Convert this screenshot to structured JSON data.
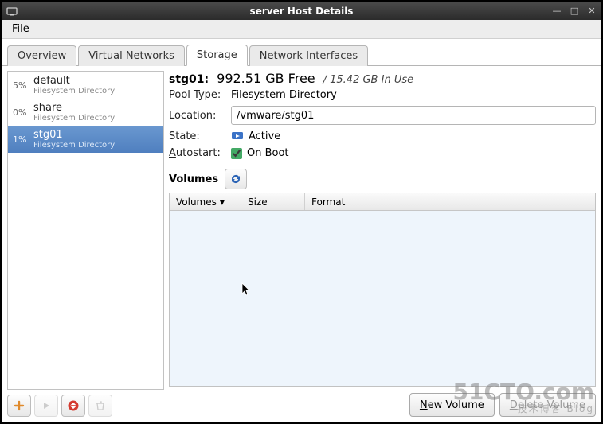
{
  "window": {
    "title": "server Host Details"
  },
  "menu": {
    "file": "File"
  },
  "tabs": {
    "overview": "Overview",
    "virtual_networks": "Virtual Networks",
    "storage": "Storage",
    "network_interfaces": "Network Interfaces",
    "active": "storage"
  },
  "pools": [
    {
      "pct": "5%",
      "name": "default",
      "sub": "Filesystem Directory",
      "selected": false
    },
    {
      "pct": "0%",
      "name": "share",
      "sub": "Filesystem Directory",
      "selected": false
    },
    {
      "pct": "1%",
      "name": "stg01",
      "sub": "Filesystem Directory",
      "selected": true
    }
  ],
  "details": {
    "pool_label": "stg01:",
    "free_text": "992.51 GB Free",
    "inuse_text": "/ 15.42 GB In Use",
    "pool_type_label": "Pool Type:",
    "pool_type_value": "Filesystem Directory",
    "location_label": "Location:",
    "location_value": "/vmware/stg01",
    "state_label": "State:",
    "state_value": "Active",
    "autostart_label": "Autostart:",
    "autostart_value": "On Boot",
    "autostart_checked": true,
    "volumes_label": "Volumes"
  },
  "volume_table": {
    "col_volumes": "Volumes",
    "col_size": "Size",
    "col_format": "Format"
  },
  "buttons": {
    "new_volume": "New Volume",
    "delete_volume": "Delete Volume"
  },
  "watermark": {
    "main": "51CTO.com",
    "sub": "技术博客   Blog"
  }
}
